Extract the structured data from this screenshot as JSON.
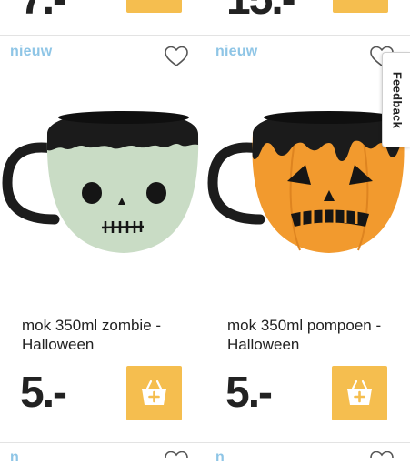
{
  "top_row": {
    "left_price_partial": "7.-",
    "right_price_partial": "15.-"
  },
  "products": [
    {
      "badge": "nieuw",
      "title": "mok 350ml zombie - Halloween",
      "price": "5.-",
      "mug_color": "#c9dcc5",
      "theme": "zombie"
    },
    {
      "badge": "nieuw",
      "title": "mok 350ml pompoen - Halloween",
      "price": "5.-",
      "mug_color": "#f29a2e",
      "theme": "pumpkin"
    }
  ],
  "bottom_row": {
    "left_badge_partial": "n",
    "right_badge_partial": "n"
  },
  "feedback": {
    "label": "Feedback"
  },
  "colors": {
    "accent_yellow": "#f5be4f",
    "badge_blue": "#8ec5e6",
    "divider": "#e3e3e3"
  },
  "icons": {
    "favorite": "heart-outline-icon",
    "add_to_cart": "basket-plus-icon"
  }
}
